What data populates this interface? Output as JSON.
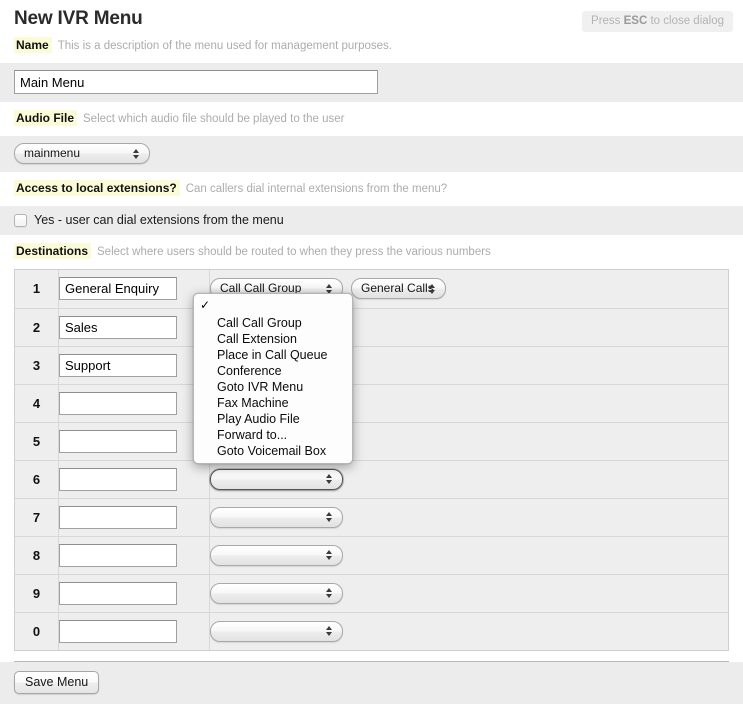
{
  "header": {
    "title": "New IVR Menu",
    "esc_prefix": "Press ",
    "esc_key": "ESC",
    "esc_suffix": " to close dialog"
  },
  "fields": {
    "name": {
      "label": "Name",
      "hint": "This is a description of the menu used for management purposes.",
      "value": "Main Menu"
    },
    "audio_file": {
      "label": "Audio File",
      "hint": "Select which audio file should be played to the user",
      "value": "mainmenu"
    },
    "local_extensions": {
      "label": "Access to local extensions?",
      "hint": "Can callers dial internal extensions from the menu?",
      "checkbox_label": "Yes - user can dial extensions from the menu",
      "checked": false
    },
    "destinations": {
      "label": "Destinations",
      "hint": "Select where users should be routed to when they press the various numbers"
    }
  },
  "destination_rows": [
    {
      "key": "1",
      "name": "General Enquiry",
      "action": "Call Call Group",
      "target": "General Calls"
    },
    {
      "key": "2",
      "name": "Sales",
      "action": "",
      "target": ""
    },
    {
      "key": "3",
      "name": "Support",
      "action": "",
      "target": ""
    },
    {
      "key": "4",
      "name": "",
      "action": "",
      "target": ""
    },
    {
      "key": "5",
      "name": "",
      "action": "",
      "target": ""
    },
    {
      "key": "6",
      "name": "",
      "action": "",
      "target": ""
    },
    {
      "key": "7",
      "name": "",
      "action": "",
      "target": ""
    },
    {
      "key": "8",
      "name": "",
      "action": "",
      "target": ""
    },
    {
      "key": "9",
      "name": "",
      "action": "",
      "target": ""
    },
    {
      "key": "0",
      "name": "",
      "action": "",
      "target": ""
    }
  ],
  "open_dropdown": {
    "selected_index": 0,
    "options": [
      "",
      "Call Call Group",
      "Call Extension",
      "Place in Call Queue",
      "Conference",
      "Goto IVR Menu",
      "Fax Machine",
      "Play Audio File",
      "Forward to...",
      "Goto Voicemail Box"
    ]
  },
  "footer": {
    "save_label": "Save Menu"
  },
  "colors": {
    "label_highlight": "#fcfbd8",
    "band_grey": "#ececec",
    "table_grey": "#eeeeee",
    "hint_grey": "#acacac"
  }
}
